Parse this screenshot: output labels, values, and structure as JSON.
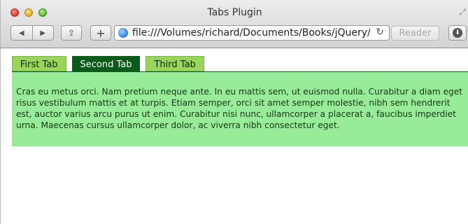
{
  "window": {
    "title": "Tabs Plugin"
  },
  "toolbar": {
    "back_icon": "back-arrow",
    "forward_icon": "forward-arrow",
    "share_icon": "share",
    "add_label": "+",
    "url": "file:///Volumes/richard/Documents/Books/jQuery/",
    "reader_label": "Reader"
  },
  "page": {
    "tabs": [
      {
        "label": "First Tab",
        "active": false
      },
      {
        "label": "Second Tab",
        "active": true
      },
      {
        "label": "Third Tab",
        "active": false
      }
    ],
    "panel_text": "Cras eu metus orci. Nam pretium neque ante. In eu mattis sem, ut euismod nulla. Curabitur a diam eget risus vestibulum mattis et at turpis. Etiam semper, orci sit amet semper molestie, nibh sem hendrerit est, auctor varius arcu purus ut enim. Curabitur nisi nunc, ullamcorper a placerat a, faucibus imperdiet urna. Maecenas cursus ullamcorper dolor, ac viverra nibh consectetur eget."
  },
  "colors": {
    "tab_inactive": "#9ad45a",
    "tab_active": "#0a5b1a",
    "panel_bg": "#98eb98"
  }
}
